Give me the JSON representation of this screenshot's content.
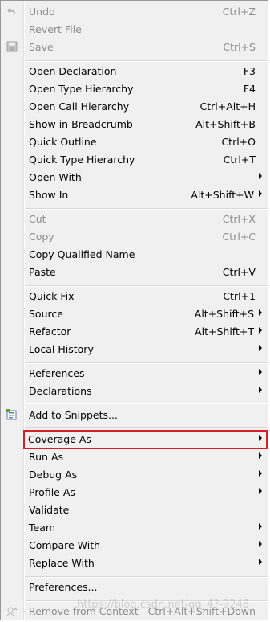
{
  "menu": {
    "items": [
      {
        "label": "Undo",
        "accel": "Ctrl+Z",
        "enabled": false,
        "submenu": false,
        "icon": "undo-icon"
      },
      {
        "label": "Revert File",
        "accel": "",
        "enabled": false,
        "submenu": false
      },
      {
        "label": "Save",
        "accel": "Ctrl+S",
        "enabled": false,
        "submenu": false,
        "icon": "save-icon"
      },
      {
        "label": "Open Declaration",
        "accel": "F3",
        "enabled": true,
        "submenu": false
      },
      {
        "label": "Open Type Hierarchy",
        "accel": "F4",
        "enabled": true,
        "submenu": false
      },
      {
        "label": "Open Call Hierarchy",
        "accel": "Ctrl+Alt+H",
        "enabled": true,
        "submenu": false
      },
      {
        "label": "Show in Breadcrumb",
        "accel": "Alt+Shift+B",
        "enabled": true,
        "submenu": false
      },
      {
        "label": "Quick Outline",
        "accel": "Ctrl+O",
        "enabled": true,
        "submenu": false
      },
      {
        "label": "Quick Type Hierarchy",
        "accel": "Ctrl+T",
        "enabled": true,
        "submenu": false
      },
      {
        "label": "Open With",
        "accel": "",
        "enabled": true,
        "submenu": true
      },
      {
        "label": "Show In",
        "accel": "Alt+Shift+W",
        "enabled": true,
        "submenu": true
      },
      {
        "label": "Cut",
        "accel": "Ctrl+X",
        "enabled": false,
        "submenu": false
      },
      {
        "label": "Copy",
        "accel": "Ctrl+C",
        "enabled": false,
        "submenu": false
      },
      {
        "label": "Copy Qualified Name",
        "accel": "",
        "enabled": true,
        "submenu": false
      },
      {
        "label": "Paste",
        "accel": "Ctrl+V",
        "enabled": true,
        "submenu": false
      },
      {
        "label": "Quick Fix",
        "accel": "Ctrl+1",
        "enabled": true,
        "submenu": false
      },
      {
        "label": "Source",
        "accel": "Alt+Shift+S",
        "enabled": true,
        "submenu": true
      },
      {
        "label": "Refactor",
        "accel": "Alt+Shift+T",
        "enabled": true,
        "submenu": true
      },
      {
        "label": "Local History",
        "accel": "",
        "enabled": true,
        "submenu": true
      },
      {
        "label": "References",
        "accel": "",
        "enabled": true,
        "submenu": true
      },
      {
        "label": "Declarations",
        "accel": "",
        "enabled": true,
        "submenu": true
      },
      {
        "label": "Add to Snippets...",
        "accel": "",
        "enabled": true,
        "submenu": false,
        "icon": "snippet-icon"
      },
      {
        "label": "Coverage As",
        "accel": "",
        "enabled": true,
        "submenu": true,
        "highlight": true
      },
      {
        "label": "Run As",
        "accel": "",
        "enabled": true,
        "submenu": true
      },
      {
        "label": "Debug As",
        "accel": "",
        "enabled": true,
        "submenu": true
      },
      {
        "label": "Profile As",
        "accel": "",
        "enabled": true,
        "submenu": true
      },
      {
        "label": "Validate",
        "accel": "",
        "enabled": true,
        "submenu": false
      },
      {
        "label": "Team",
        "accel": "",
        "enabled": true,
        "submenu": true
      },
      {
        "label": "Compare With",
        "accel": "",
        "enabled": true,
        "submenu": true
      },
      {
        "label": "Replace With",
        "accel": "",
        "enabled": true,
        "submenu": true
      },
      {
        "label": "Preferences...",
        "accel": "",
        "enabled": true,
        "submenu": false
      },
      {
        "label": "Remove from Context",
        "accel": "Ctrl+Alt+Shift+Down",
        "enabled": false,
        "submenu": false,
        "icon": "context-icon"
      }
    ]
  },
  "watermark": "https://blog.csdn.net/qq_4?-9248",
  "colors": {
    "highlight_border": "#d61f26",
    "disabled_text": "#8d8d8d"
  }
}
